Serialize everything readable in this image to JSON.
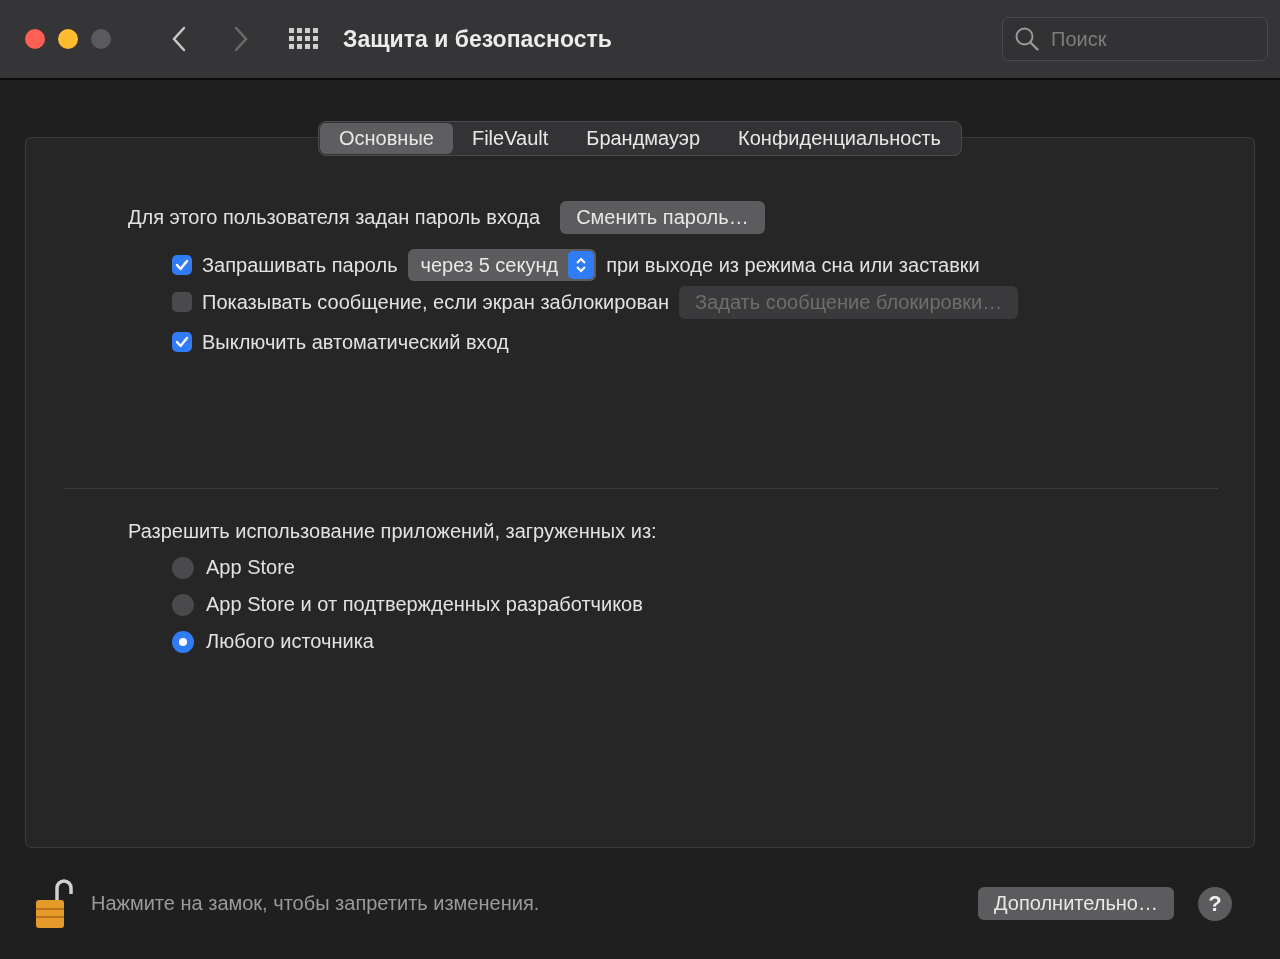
{
  "window": {
    "title": "Защита и безопасность",
    "search": {
      "placeholder": "Поиск"
    }
  },
  "tabs": [
    {
      "label": "Основные",
      "selected": true
    },
    {
      "label": "FileVault",
      "selected": false
    },
    {
      "label": "Брандмауэр",
      "selected": false
    },
    {
      "label": "Конфиденциальность",
      "selected": false
    }
  ],
  "general": {
    "password_label": "Для этого пользователя задан пароль входа",
    "change_password_button": "Сменить пароль…",
    "options": [
      {
        "kind": "delay",
        "checked": true,
        "label": "Запрашивать пароль",
        "select_value": "через 5 секунд",
        "suffix": "при выходе из режима сна или заставки"
      },
      {
        "kind": "message",
        "checked": false,
        "label": "Показывать сообщение, если экран заблокирован",
        "button": "Задать сообщение блокировки…",
        "button_disabled": true
      },
      {
        "kind": "plain",
        "checked": true,
        "label": "Выключить автоматический вход"
      }
    ]
  },
  "downloads": {
    "label": "Разрешить использование приложений, загруженных из:",
    "options": [
      {
        "label": "App Store",
        "selected": false
      },
      {
        "label": "App Store и от подтвержденных разработчиков",
        "selected": false
      },
      {
        "label": "Любого источника",
        "selected": true
      }
    ]
  },
  "footer": {
    "lock_text": "Нажмите на замок, чтобы запретить изменения.",
    "advanced_button": "Дополнительно…",
    "help_button": "?"
  }
}
